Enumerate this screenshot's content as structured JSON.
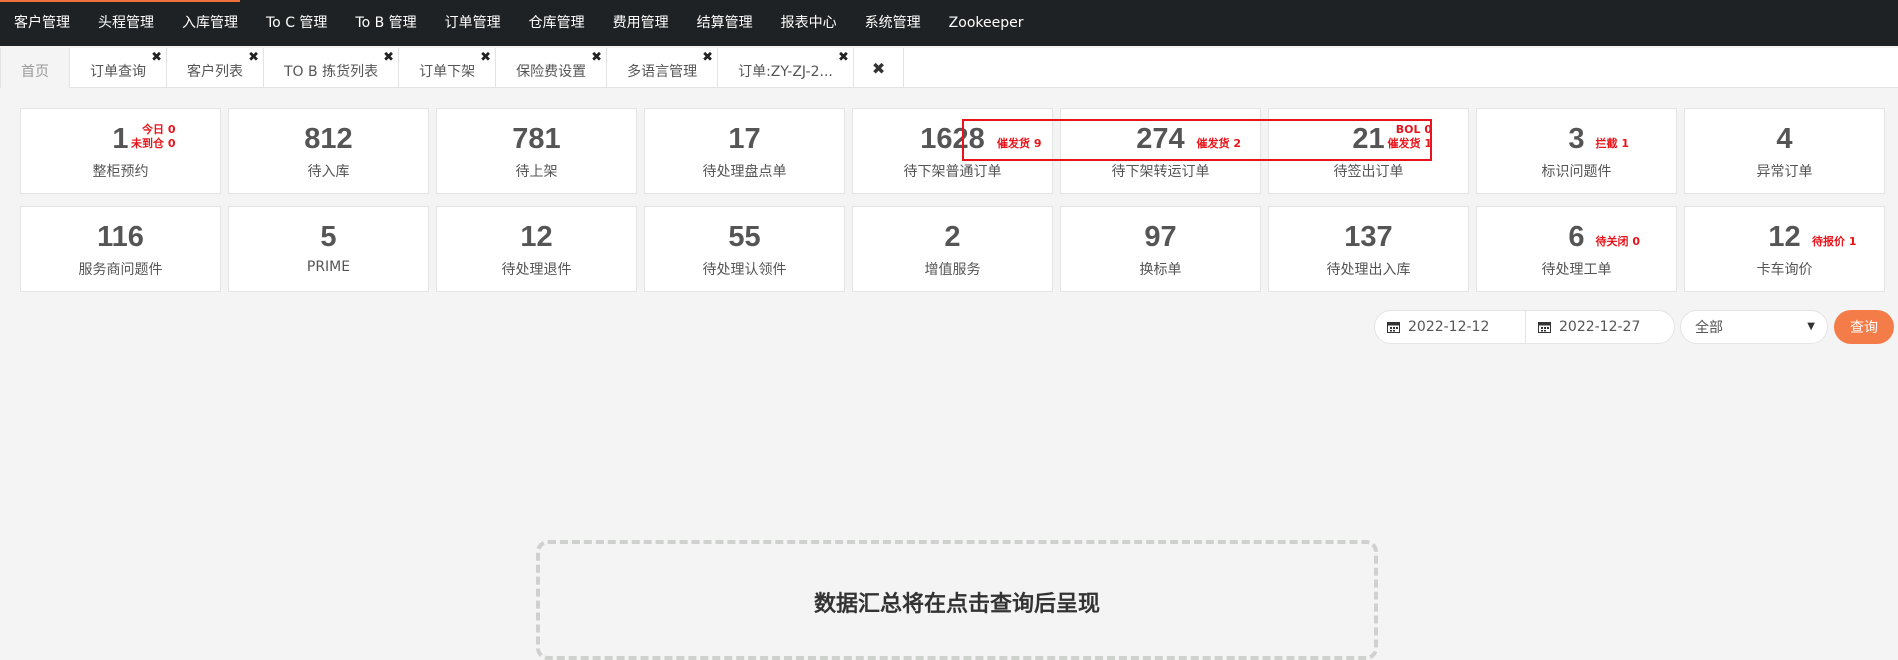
{
  "nav": {
    "items": [
      "客户管理",
      "头程管理",
      "入库管理",
      "To C 管理",
      "To B 管理",
      "订单管理",
      "仓库管理",
      "费用管理",
      "结算管理",
      "报表中心",
      "系统管理",
      "Zookeeper"
    ],
    "accent_color": "#f0703a"
  },
  "tabs": [
    {
      "label": "首页",
      "closable": false
    },
    {
      "label": "订单查询",
      "closable": true
    },
    {
      "label": "客户列表",
      "closable": true
    },
    {
      "label": "TO B 拣货列表",
      "closable": true
    },
    {
      "label": "订单下架",
      "closable": true
    },
    {
      "label": "保险费设置",
      "closable": true
    },
    {
      "label": "多语言管理",
      "closable": true
    },
    {
      "label": "订单:ZY-ZJ-2...",
      "closable": true
    }
  ],
  "close_glyph": "✖",
  "stats": [
    {
      "value": "1",
      "label": "整柜预约",
      "subs": [
        "今日 0",
        "未到仓 0"
      ]
    },
    {
      "value": "812",
      "label": "待入库",
      "subs": []
    },
    {
      "value": "781",
      "label": "待上架",
      "subs": []
    },
    {
      "value": "17",
      "label": "待处理盘点单",
      "subs": []
    },
    {
      "value": "1628",
      "label": "待下架普通订单",
      "subs": [
        "催发货 9"
      ]
    },
    {
      "value": "274",
      "label": "待下架转运订单",
      "subs": [
        "催发货 2"
      ]
    },
    {
      "value": "21",
      "label": "待签出订单",
      "subs": [
        "BOL 0",
        "催发货 1"
      ]
    },
    {
      "value": "3",
      "label": "标识问题件",
      "subs": [
        "拦截 1"
      ]
    },
    {
      "value": "4",
      "label": "异常订单",
      "subs": []
    },
    {
      "value": "116",
      "label": "服务商问题件",
      "subs": []
    },
    {
      "value": "5",
      "label": "PRIME",
      "subs": []
    },
    {
      "value": "12",
      "label": "待处理退件",
      "subs": []
    },
    {
      "value": "55",
      "label": "待处理认领件",
      "subs": []
    },
    {
      "value": "2",
      "label": "增值服务",
      "subs": []
    },
    {
      "value": "97",
      "label": "换标单",
      "subs": []
    },
    {
      "value": "137",
      "label": "待处理出入库",
      "subs": []
    },
    {
      "value": "6",
      "label": "待处理工单",
      "subs": [
        "待关闭 0"
      ]
    },
    {
      "value": "12",
      "label": "卡车询价",
      "subs": [
        "待报价 1"
      ]
    }
  ],
  "filter": {
    "start_date": "2022-12-12",
    "end_date": "2022-12-27",
    "select_value": "全部",
    "query_label": "查询",
    "button_color": "#f47c48"
  },
  "placeholder": {
    "text": "数据汇总将在点击查询后呈现"
  },
  "highlight_color": "#e8141b"
}
